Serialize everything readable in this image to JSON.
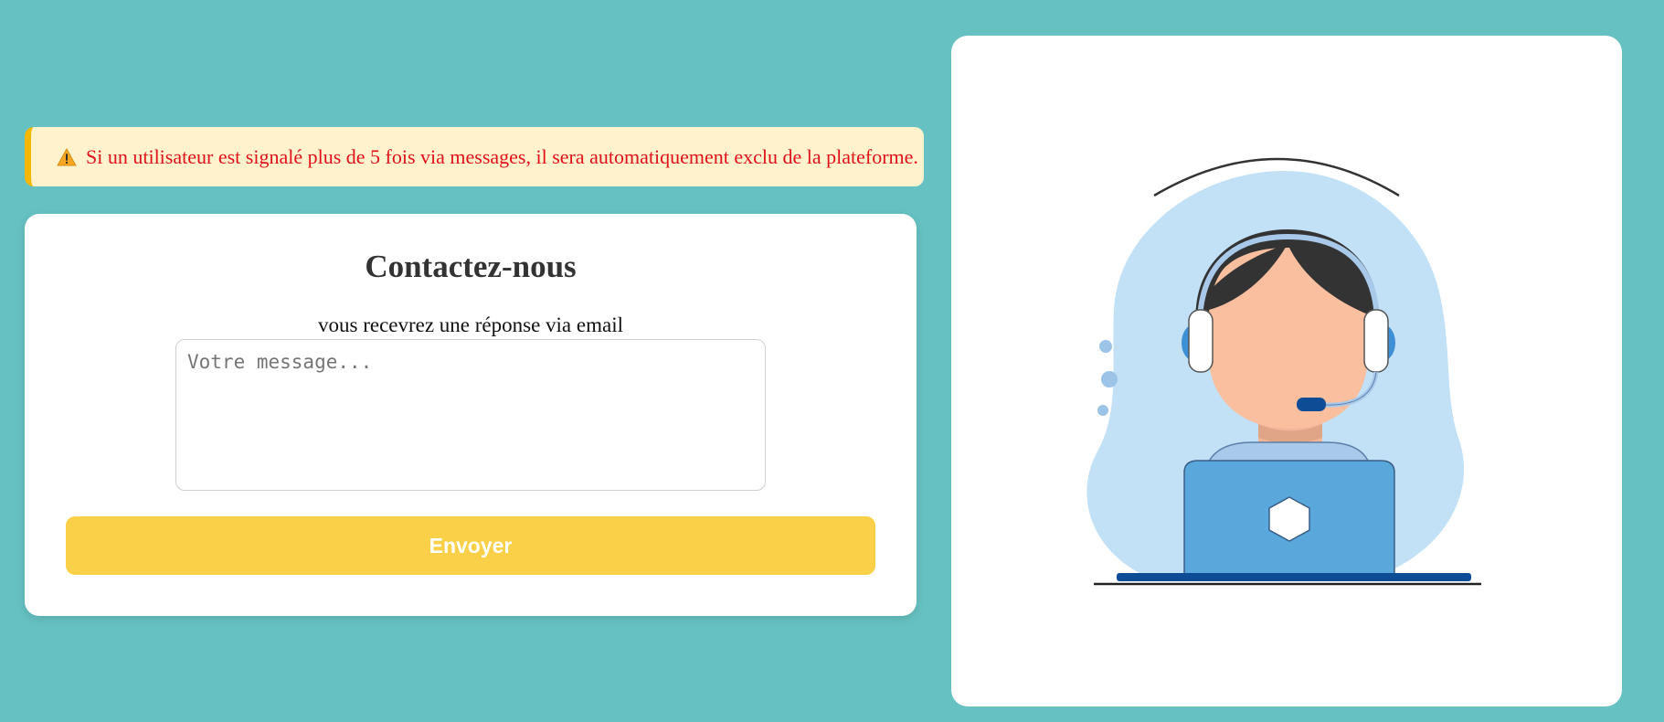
{
  "alert": {
    "icon": "warning-icon",
    "text": "Si un utilisateur est signalé plus de 5 fois via messages, il sera automatiquement exclu de la plateforme."
  },
  "contact": {
    "title": "Contactez-nous",
    "subtitle": "vous recevrez une réponse via email",
    "message_value": "",
    "message_placeholder": "Votre message...",
    "submit_label": "Envoyer"
  },
  "illustration": {
    "icon": "customer-support-agent-illustration"
  },
  "colors": {
    "background": "#66c1c2",
    "alert_bg": "#fff2cc",
    "alert_border": "#f5b800",
    "alert_text": "#e0111b",
    "button_bg": "#f9d048",
    "button_text": "#ffffff"
  }
}
